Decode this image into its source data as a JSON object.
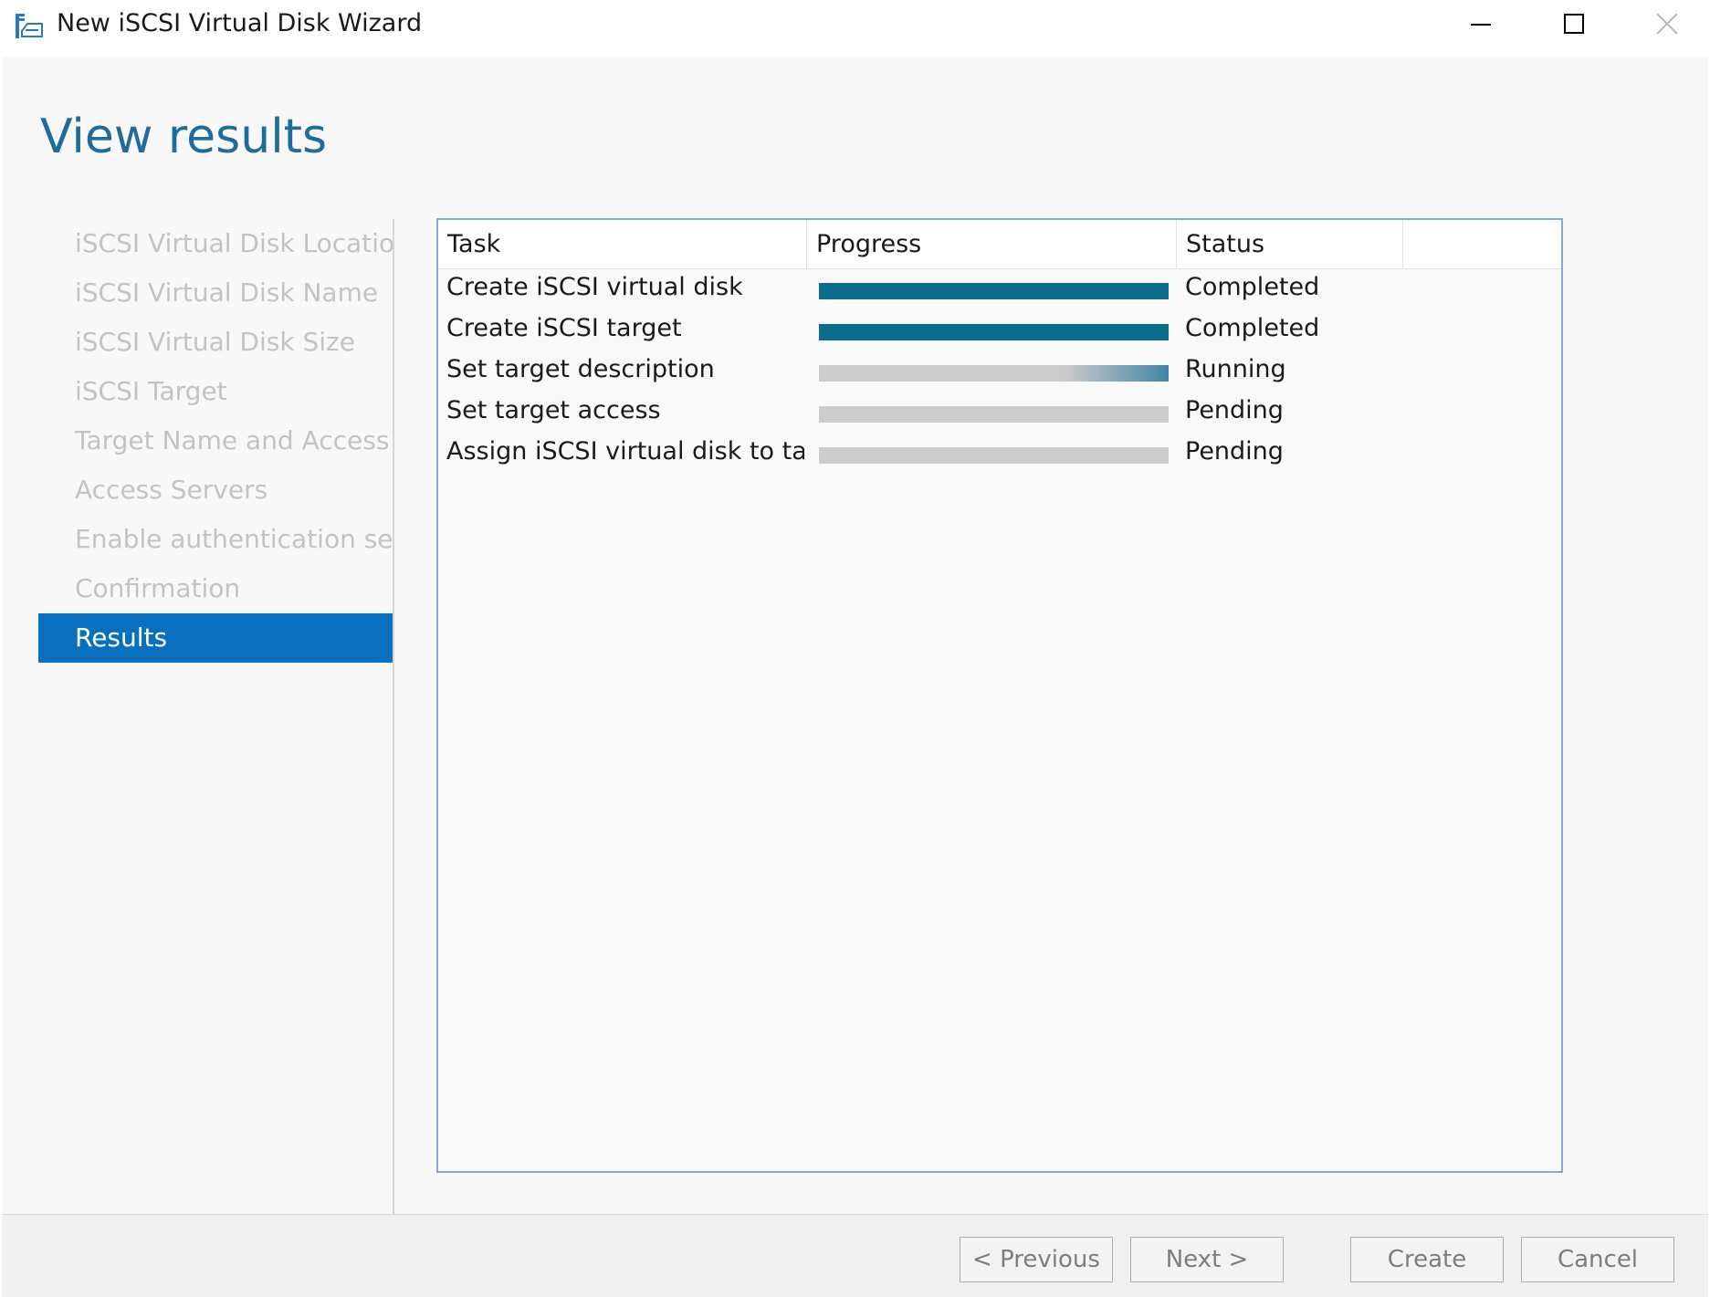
{
  "window": {
    "title": "New iSCSI Virtual Disk Wizard",
    "controls": [
      "minimize",
      "maximize",
      "close"
    ]
  },
  "page": {
    "title": "View results"
  },
  "nav": {
    "items": [
      {
        "label": "iSCSI Virtual Disk Location",
        "state": "disabled"
      },
      {
        "label": "iSCSI Virtual Disk Name",
        "state": "disabled"
      },
      {
        "label": "iSCSI Virtual Disk Size",
        "state": "disabled"
      },
      {
        "label": "iSCSI Target",
        "state": "disabled"
      },
      {
        "label": "Target Name and Access",
        "state": "disabled"
      },
      {
        "label": "Access Servers",
        "state": "disabled"
      },
      {
        "label": "Enable authentication ser...",
        "state": "disabled"
      },
      {
        "label": "Confirmation",
        "state": "disabled"
      },
      {
        "label": "Results",
        "state": "active"
      }
    ]
  },
  "results": {
    "columns": [
      "Task",
      "Progress",
      "Status"
    ],
    "rows": [
      {
        "task": "Create iSCSI virtual disk",
        "progress": 1.0,
        "status": "Completed"
      },
      {
        "task": "Create iSCSI target",
        "progress": 1.0,
        "status": "Completed"
      },
      {
        "task": "Set target description",
        "progress": 0.0,
        "status": "Running"
      },
      {
        "task": "Set target access",
        "progress": 0.0,
        "status": "Pending"
      },
      {
        "task": "Assign iSCSI virtual disk to target",
        "progress": 0.0,
        "status": "Pending"
      }
    ]
  },
  "footer": {
    "previous_label": "< Previous",
    "next_label": "Next >",
    "create_label": "Create",
    "cancel_label": "Cancel"
  },
  "colors": {
    "accent": "#0870bf",
    "title": "#1e6c9a",
    "progress": "#0a6d8d",
    "progress_track": "#cccccc"
  },
  "icons": {
    "app": "wizard-disk-icon"
  }
}
